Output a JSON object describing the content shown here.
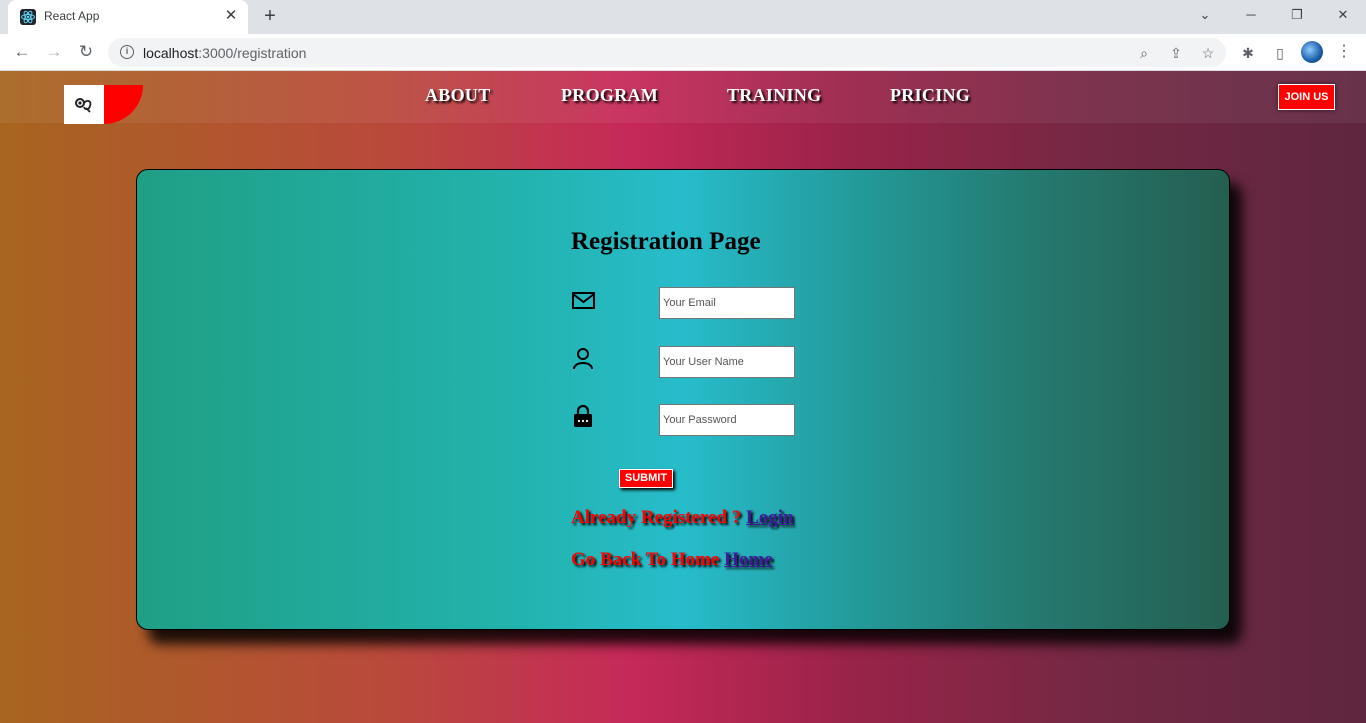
{
  "browser": {
    "tab_title": "React App",
    "tab_close": "✕",
    "new_tab": "+",
    "url_host": "localhost",
    "url_rest": ":3000/registration",
    "window_controls": {
      "minimize": "─",
      "restore": "❐",
      "close": "✕",
      "dropdown": "⌄"
    },
    "icons": [
      "back-icon",
      "forward-icon",
      "reload-icon",
      "info-icon",
      "zoom-icon",
      "share-icon",
      "bookmark-star-icon",
      "extensions-icon",
      "side-panel-icon",
      "profile-avatar",
      "menu-icon"
    ]
  },
  "navbar": {
    "links": [
      "ABOUT",
      "PROGRAM",
      "TRAINING",
      "PRICING"
    ],
    "join_label": "JOIN US",
    "accent": "#ff0000"
  },
  "form": {
    "title": "Registration Page",
    "email_placeholder": "Your Email",
    "username_placeholder": "Your User Name",
    "password_placeholder": "Your Password",
    "submit_label": "SUBMIT",
    "login_prompt": "Already Registered ? ",
    "login_link": "Login",
    "home_prompt": "Go Back To Home ",
    "home_link": "Home"
  }
}
